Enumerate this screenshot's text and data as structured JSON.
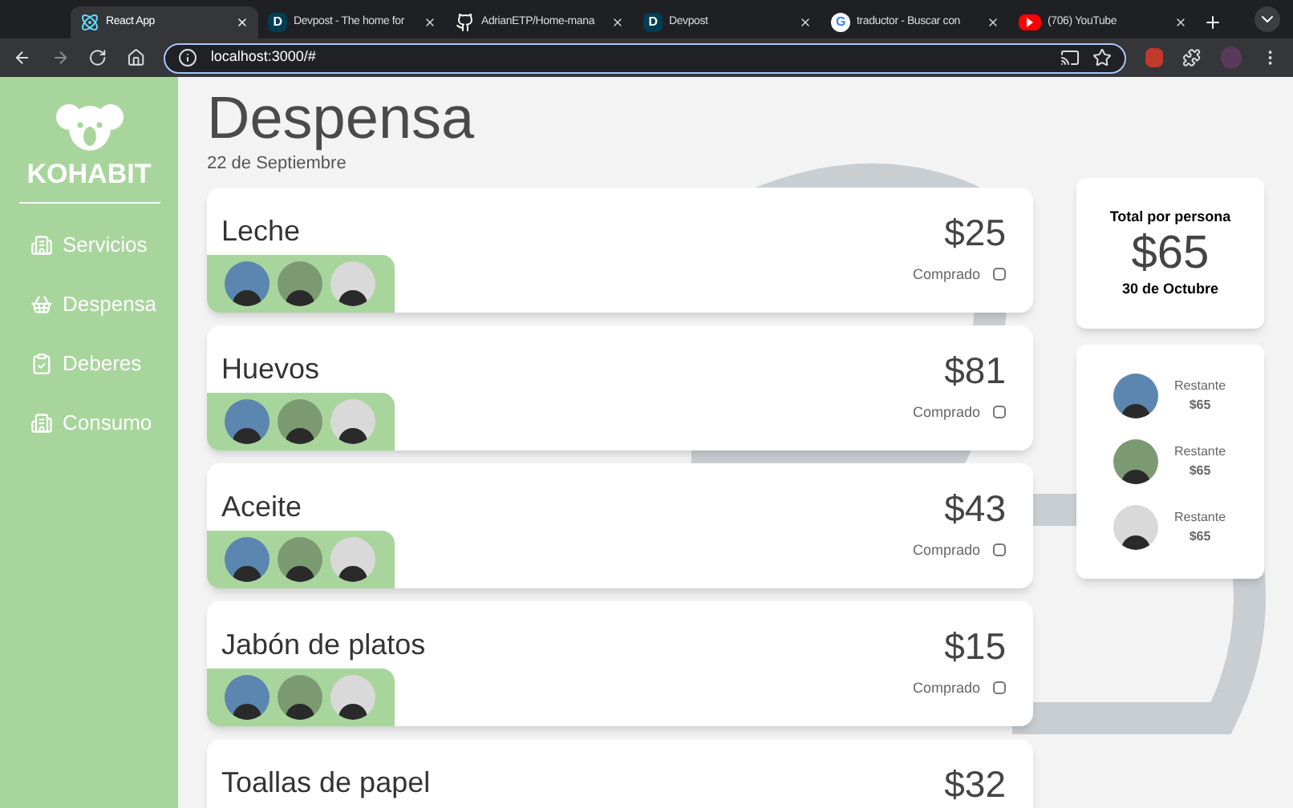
{
  "browser": {
    "tabs": [
      {
        "title": "React App",
        "selected": true,
        "kind": "react"
      },
      {
        "title": "Devpost - The home for",
        "selected": false,
        "kind": "letter",
        "favicon_text": "D"
      },
      {
        "title": "AdrianETP/Home-mana",
        "selected": false,
        "kind": "github"
      },
      {
        "title": "Devpost",
        "selected": false,
        "kind": "letter",
        "favicon_text": "D"
      },
      {
        "title": "traductor - Buscar con",
        "selected": false,
        "kind": "google",
        "favicon_text": "G"
      },
      {
        "title": "(706) YouTube",
        "selected": false,
        "kind": "video"
      }
    ],
    "url": "localhost:3000/#"
  },
  "sidebar": {
    "brand": "KOHABIT",
    "items": [
      {
        "label": "Servicios",
        "kind": "building"
      },
      {
        "label": "Despensa",
        "kind": "basket"
      },
      {
        "label": "Deberes",
        "kind": "clipboard"
      },
      {
        "label": "Consumo",
        "kind": "building"
      }
    ]
  },
  "page": {
    "title": "Despensa",
    "date": "22 de Septiembre"
  },
  "items": [
    {
      "name": "Leche",
      "price": "$25",
      "status_label": "Comprado",
      "checked": false,
      "show_people": true
    },
    {
      "name": "Huevos",
      "price": "$81",
      "status_label": "Comprado",
      "checked": false,
      "show_people": true
    },
    {
      "name": "Aceite",
      "price": "$43",
      "status_label": "Comprado",
      "checked": false,
      "show_people": true
    },
    {
      "name": "Jabón de platos",
      "price": "$15",
      "status_label": "Comprado",
      "checked": false,
      "show_people": true
    },
    {
      "name": "Toallas de papel",
      "price": "$32",
      "show_people": false
    }
  ],
  "summary": {
    "label": "Total por persona",
    "amount": "$65",
    "date": "30 de Octubre"
  },
  "people": [
    {
      "label": "Restante",
      "amount": "$65"
    },
    {
      "label": "Restante",
      "amount": "$65"
    },
    {
      "label": "Restante",
      "amount": "$65"
    }
  ]
}
